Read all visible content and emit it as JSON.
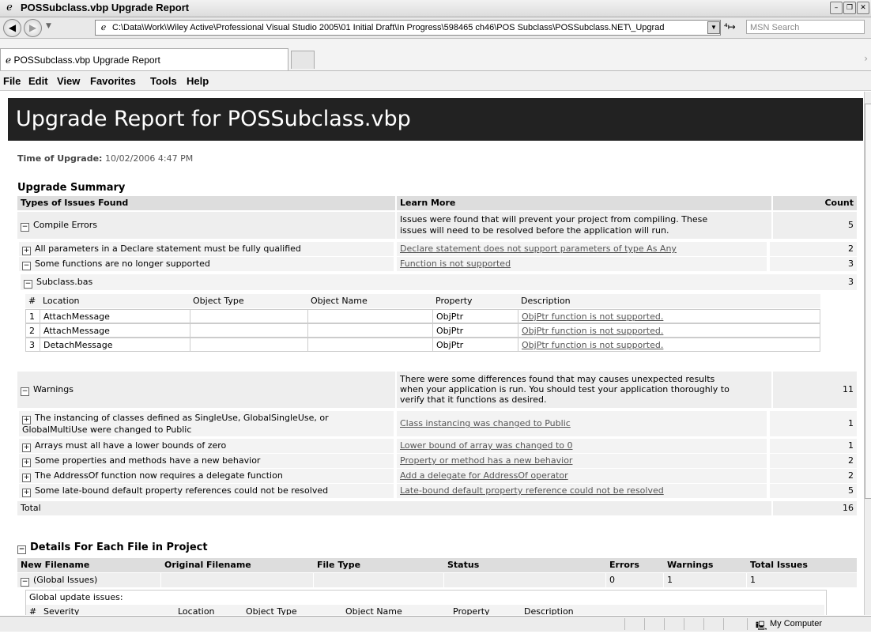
{
  "window": {
    "title": "POSSubclass.vbp Upgrade Report"
  },
  "address": {
    "url": "C:\\Data\\Work\\Wiley Active\\Professional Visual Studio 2005\\01 Initial Draft\\In Progress\\598465 ch46\\POS Subclass\\POSSubclass.NET\\_Upgrad",
    "search_placeholder": "MSN Search"
  },
  "tab": {
    "label": "POSSubclass.vbp Upgrade Report"
  },
  "menu": [
    "File",
    "Edit",
    "View",
    "Favorites",
    "Tools",
    "Help"
  ],
  "report": {
    "title": "Upgrade Report for POSSubclass.vbp",
    "time_label": "Time of Upgrade:",
    "time_value": "10/02/2006 4:47 PM",
    "summary_heading": "Upgrade Summary",
    "summary_headers": [
      "Types of Issues Found",
      "Learn More",
      "Count"
    ],
    "compile_errors": {
      "label": "Compile Errors",
      "desc_line1": "Issues were found that will prevent your project from compiling. These",
      "desc_line2": "issues will need to be resolved before the application will run.",
      "count": "5",
      "items": [
        {
          "label": "All parameters in a Declare statement must be fully qualified",
          "link": "Declare statement does not support parameters of type As Any",
          "count": "2",
          "expander": "+"
        },
        {
          "label": "Some functions are no longer supported",
          "link": "Function is not supported",
          "count": "3",
          "expander": "−"
        }
      ],
      "file": {
        "name": "Subclass.bas",
        "count": "3"
      },
      "file_headers": [
        "#",
        "Location",
        "Object Type",
        "Object Name",
        "Property",
        "Description"
      ],
      "file_rows": [
        {
          "n": "1",
          "location": "AttachMessage",
          "object_type": "",
          "object_name": "",
          "property": "ObjPtr",
          "description": "ObjPtr function is not supported."
        },
        {
          "n": "2",
          "location": "AttachMessage",
          "object_type": "",
          "object_name": "",
          "property": "ObjPtr",
          "description": "ObjPtr function is not supported."
        },
        {
          "n": "3",
          "location": "DetachMessage",
          "object_type": "",
          "object_name": "",
          "property": "ObjPtr",
          "description": "ObjPtr function is not supported."
        }
      ]
    },
    "warnings": {
      "label": "Warnings",
      "desc_line1": "There were some differences found that may causes unexpected results",
      "desc_line2": "when your application is run. You should test your application thoroughly to",
      "desc_line3": "verify that it functions as desired.",
      "count": "11",
      "item0_line1": "The instancing of classes defined as SingleUse, GlobalSingleUse, or",
      "item0_line2": "GlobalMultiUse were changed to Public",
      "item0_link": "Class instancing was changed to Public",
      "item0_count": "1",
      "items": [
        {
          "label": "Arrays must all have a lower bounds of zero",
          "link": "Lower bound of array was changed to 0",
          "count": "1"
        },
        {
          "label": "Some properties and methods have a new behavior",
          "link": "Property or method has a new behavior",
          "count": "2"
        },
        {
          "label": "The AddressOf function now requires a delegate function",
          "link": "Add a delegate for AddressOf operator",
          "count": "2"
        },
        {
          "label": "Some late-bound default property references could not be resolved",
          "link": "Late-bound default property reference could not be resolved",
          "count": "5"
        }
      ]
    },
    "total_label": "Total",
    "total_count": "16",
    "details_heading": "Details For Each File in Project",
    "details_headers": [
      "New Filename",
      "Original Filename",
      "File Type",
      "Status",
      "Errors",
      "Warnings",
      "Total Issues"
    ],
    "global_row": {
      "name": "(Global Issues)",
      "original": "",
      "type": "",
      "status": "",
      "errors": "0",
      "warnings": "1",
      "total": "1"
    },
    "global_update_label": "Global update issues:",
    "global_headers": [
      "#",
      "Severity",
      "Location",
      "Object Type",
      "Object Name",
      "Property",
      "Description"
    ]
  },
  "status": {
    "zone": "My Computer"
  }
}
